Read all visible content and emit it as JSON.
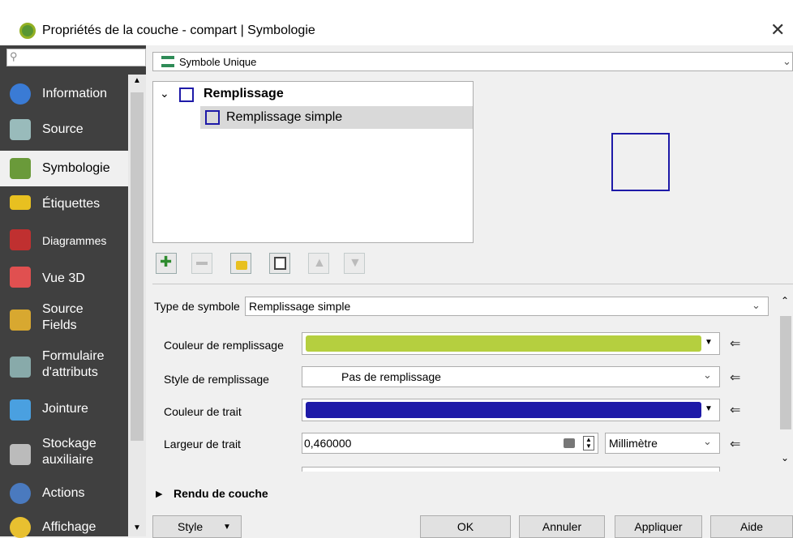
{
  "window": {
    "title": "Propriétés de la couche - compart | Symbologie",
    "close_glyph": "✕"
  },
  "search": {
    "placeholder": ""
  },
  "sidebar": {
    "items": [
      {
        "label": "Information",
        "icon": "info-icon",
        "color": "#3a7bd5"
      },
      {
        "label": "Source",
        "icon": "source-icon",
        "color": "#9bb"
      },
      {
        "label": "Symbologie",
        "icon": "symbology-brush-icon",
        "color": "#6a9a3a"
      },
      {
        "label": "Étiquettes",
        "icon": "labels-abc-icon",
        "color": "#e8c020"
      },
      {
        "label": "Diagrammes",
        "icon": "diagrams-icon",
        "color": "#c03030"
      },
      {
        "label": "Vue 3D",
        "icon": "3d-view-icon",
        "color": "#e05050"
      },
      {
        "label": "Source\nFields",
        "icon": "source-fields-icon",
        "color": "#d8a830"
      },
      {
        "label": "Formulaire\nd'attributs",
        "icon": "attributes-form-icon",
        "color": "#8aa"
      },
      {
        "label": "Jointure",
        "icon": "join-icon",
        "color": "#4aa0e0"
      },
      {
        "label": "Stockage\nauxiliaire",
        "icon": "auxiliary-storage-icon",
        "color": "#bbb"
      },
      {
        "label": "Actions",
        "icon": "actions-gear-icon",
        "color": "#4a7abf"
      },
      {
        "label": "Affichage",
        "icon": "display-bubble-icon",
        "color": "#e8c030"
      }
    ]
  },
  "renderer": {
    "value": "Symbole Unique"
  },
  "tree": {
    "root": "Remplissage",
    "child": "Remplissage simple"
  },
  "symbol_type": {
    "label": "Type de symbole",
    "value": "Remplissage simple"
  },
  "properties": {
    "fill_color_label": "Couleur de remplissage",
    "fill_color": "#b5cf3f",
    "fill_style_label": "Style de remplissage",
    "fill_style_value": "Pas de remplissage",
    "stroke_color_label": "Couleur de trait",
    "stroke_color": "#1e1aa8",
    "stroke_width_label": "Largeur de trait",
    "stroke_width_value": "0,460000",
    "unit_value": "Millimètre"
  },
  "layer_rendering": {
    "label": "Rendu de couche"
  },
  "buttons": {
    "style": "Style",
    "ok": "OK",
    "cancel": "Annuler",
    "apply": "Appliquer",
    "help": "Aide"
  }
}
